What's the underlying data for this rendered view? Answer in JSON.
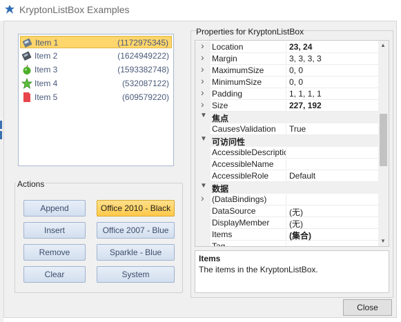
{
  "window": {
    "title": "KryptonListBox Examples",
    "icon": "krypton-app-icon"
  },
  "listbox": {
    "items": [
      {
        "label": "Item 1",
        "value": "(1172975345)",
        "icon": "mobile-phone-icon",
        "selected": true
      },
      {
        "label": "Item 2",
        "value": "(1624949222)",
        "icon": "mobile-phone-icon",
        "selected": false
      },
      {
        "label": "Item 3",
        "value": "(1593382748)",
        "icon": "apple-icon",
        "selected": false
      },
      {
        "label": "Item 4",
        "value": "(532087122)",
        "icon": "star-icon",
        "selected": false
      },
      {
        "label": "Item 5",
        "value": "(609579220)",
        "icon": "document-icon",
        "selected": false
      }
    ]
  },
  "actions": {
    "label": "Actions",
    "append": "Append",
    "insert": "Insert",
    "remove": "Remove",
    "clear": "Clear",
    "themes": [
      "Office 2010 - Black",
      "Office 2007 - Blue",
      "Sparkle - Blue",
      "System"
    ],
    "active_theme": "Office 2010 - Black"
  },
  "properties": {
    "label": "Properties for KryptonListBox",
    "rows": [
      {
        "kind": "prop",
        "name": "Location",
        "value": "23, 24",
        "bold": true,
        "expandable": true
      },
      {
        "kind": "prop",
        "name": "Margin",
        "value": "3, 3, 3, 3",
        "bold": false,
        "expandable": true
      },
      {
        "kind": "prop",
        "name": "MaximumSize",
        "value": "0, 0",
        "bold": false,
        "expandable": true
      },
      {
        "kind": "prop",
        "name": "MinimumSize",
        "value": "0, 0",
        "bold": false,
        "expandable": true
      },
      {
        "kind": "prop",
        "name": "Padding",
        "value": "1, 1, 1, 1",
        "bold": false,
        "expandable": true
      },
      {
        "kind": "prop",
        "name": "Size",
        "value": "227, 192",
        "bold": true,
        "expandable": true
      },
      {
        "kind": "category",
        "name": "焦点"
      },
      {
        "kind": "prop",
        "name": "CausesValidation",
        "value": "True",
        "bold": false,
        "expandable": false
      },
      {
        "kind": "category",
        "name": "可访问性"
      },
      {
        "kind": "prop",
        "name": "AccessibleDescription",
        "value": "",
        "bold": false,
        "expandable": false
      },
      {
        "kind": "prop",
        "name": "AccessibleName",
        "value": "",
        "bold": false,
        "expandable": false
      },
      {
        "kind": "prop",
        "name": "AccessibleRole",
        "value": "Default",
        "bold": false,
        "expandable": false
      },
      {
        "kind": "category",
        "name": "数据"
      },
      {
        "kind": "prop",
        "name": "(DataBindings)",
        "value": "",
        "bold": false,
        "expandable": true
      },
      {
        "kind": "prop",
        "name": "DataSource",
        "value": "(无)",
        "bold": false,
        "expandable": false
      },
      {
        "kind": "prop",
        "name": "DisplayMember",
        "value": "(无)",
        "bold": false,
        "expandable": false
      },
      {
        "kind": "prop",
        "name": "Items",
        "value": "(集合)",
        "bold": true,
        "expandable": false
      },
      {
        "kind": "prop",
        "name": "Tag",
        "value": "",
        "bold": false,
        "expandable": false
      }
    ],
    "description": {
      "title": "Items",
      "text": "The items in the KryptonListBox."
    }
  },
  "footer": {
    "close": "Close"
  }
}
